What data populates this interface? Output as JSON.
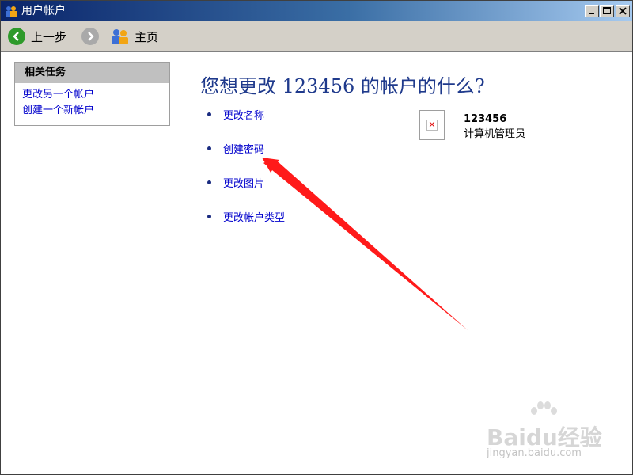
{
  "window": {
    "title": "用户帐户"
  },
  "toolbar": {
    "back_label": "上一步",
    "home_label": "主页"
  },
  "task_panel": {
    "header": "相关任务",
    "links": [
      "更改另一个帐户",
      "创建一个新帐户"
    ]
  },
  "main": {
    "title": "您想更改 123456 的帐户的什么?",
    "options": [
      "更改名称",
      "创建密码",
      "更改图片",
      "更改帐户类型"
    ]
  },
  "user": {
    "name": "123456",
    "role": "计算机管理员"
  },
  "watermark": {
    "brand": "Baidu经验",
    "url": "jingyan.baidu.com"
  },
  "colors": {
    "title_blue": "#1f3a8c",
    "link_blue": "#0000cc",
    "arrow_red": "#ff1a1a"
  }
}
